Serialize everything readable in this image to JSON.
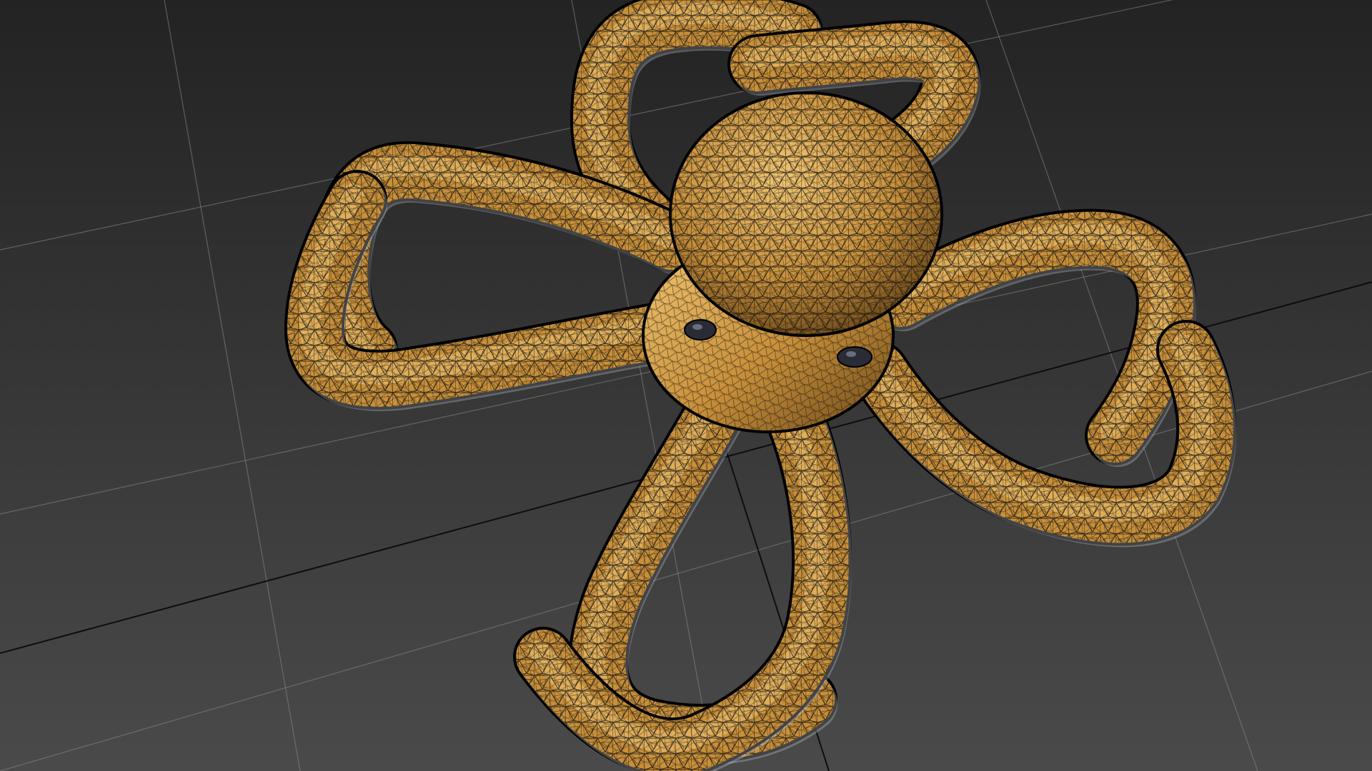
{
  "viewport": {
    "background_top": "#232323",
    "background_bottom": "#4a4a4a",
    "grid_color": "#8a8a8a",
    "grid_axis_color": "#0d0d0d",
    "grid_visible": true
  },
  "model": {
    "subject": "octopus",
    "display_mode": "shaded-wireframe",
    "base_color": "#c9903a",
    "highlight_color": "#f2c672",
    "shadow_color": "#6b4818",
    "wire_color": "#111111",
    "underside_color": "#b9c0cc",
    "tentacle_count": 8
  }
}
